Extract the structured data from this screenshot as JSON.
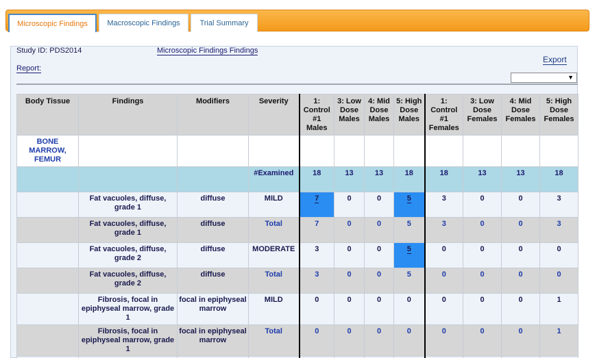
{
  "tabs": [
    {
      "label": "Microscopic Findings",
      "active": true
    },
    {
      "label": "Macroscopic Findings",
      "active": false
    },
    {
      "label": "Trial Summary",
      "active": false
    }
  ],
  "header": {
    "study_id": "Study ID: PDS2014",
    "findings_link": "Microscopic Findings Findings",
    "report_link": "Report:",
    "export_link": "Export",
    "export_select_value": "",
    "dropdown_glyph": "▼"
  },
  "table": {
    "columns": [
      "Body Tissue",
      "Findings",
      "Modifiers",
      "Severity",
      "1: Control #1 Males",
      "3: Low Dose Males",
      "4: Mid Dose Males",
      "5: High Dose Males",
      "1: Control #1 Females",
      "3: Low Dose Females",
      "4: Mid Dose Females",
      "5: High Dose Females"
    ],
    "tissue": "BONE MARROW, FEMUR",
    "examined": {
      "label": "#Examined",
      "values": [
        "18",
        "13",
        "13",
        "18",
        "18",
        "13",
        "13",
        "18"
      ]
    },
    "rows": [
      {
        "finding": "Fat vacuoles, diffuse, grade 1",
        "modifier": "diffuse",
        "severity": "MILD",
        "values": [
          "7",
          "0",
          "0",
          "5",
          "3",
          "0",
          "0",
          "3"
        ],
        "style": "light",
        "highlight": [
          0,
          3
        ]
      },
      {
        "finding": "Fat vacuoles, diffuse, grade 1",
        "modifier": "diffuse",
        "severity": "Total",
        "values": [
          "7",
          "0",
          "0",
          "5",
          "3",
          "0",
          "0",
          "3"
        ],
        "style": "dark",
        "highlight": []
      },
      {
        "finding": "Fat vacuoles, diffuse, grade 2",
        "modifier": "diffuse",
        "severity": "MODERATE",
        "values": [
          "3",
          "0",
          "0",
          "5",
          "0",
          "0",
          "0",
          "0"
        ],
        "style": "light",
        "highlight": [
          3
        ]
      },
      {
        "finding": "Fat vacuoles, diffuse, grade 2",
        "modifier": "diffuse",
        "severity": "Total",
        "values": [
          "3",
          "0",
          "0",
          "5",
          "0",
          "0",
          "0",
          "0"
        ],
        "style": "dark",
        "highlight": []
      },
      {
        "finding": "Fibrosis, focal in epiphyseal marrow, grade 1",
        "modifier": "focal in epiphyseal marrow",
        "severity": "MILD",
        "values": [
          "0",
          "0",
          "0",
          "0",
          "0",
          "0",
          "0",
          "1"
        ],
        "style": "light",
        "highlight": []
      },
      {
        "finding": "Fibrosis, focal in epiphyseal marrow, grade 1",
        "modifier": "focal in epiphyseal marrow",
        "severity": "Total",
        "values": [
          "0",
          "0",
          "0",
          "0",
          "0",
          "0",
          "0",
          "1"
        ],
        "style": "dark",
        "highlight": []
      }
    ]
  }
}
